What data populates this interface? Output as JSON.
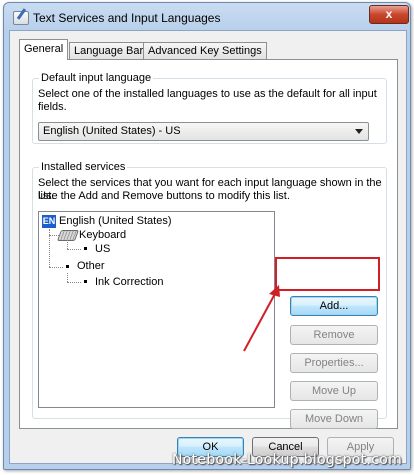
{
  "window": {
    "title": "Text Services and Input Languages",
    "close_glyph": "x"
  },
  "tabs": [
    {
      "label": "General",
      "active": true
    },
    {
      "label": "Language Bar",
      "active": false
    },
    {
      "label": "Advanced Key Settings",
      "active": false
    }
  ],
  "default_input": {
    "legend": "Default input language",
    "description_line1": "Select one of the installed languages to use as the default for all input",
    "description_line2": "fields.",
    "selected": "English (United States) - US"
  },
  "installed_services": {
    "legend": "Installed services",
    "description_line1": "Select the services that you want for each input language shown in the list.",
    "description_line2": "Use the Add and Remove buttons to modify this list.",
    "tree": {
      "language_badge": "EN",
      "language": "English (United States)",
      "keyboard": "Keyboard",
      "keyboard_layout": "US",
      "other": "Other",
      "other_service": "Ink Correction"
    },
    "buttons": {
      "add": "Add...",
      "remove": "Remove",
      "properties": "Properties...",
      "move_up": "Move Up",
      "move_down": "Move Down"
    }
  },
  "dialog_buttons": {
    "ok": "OK",
    "cancel": "Cancel",
    "apply": "Apply"
  },
  "watermark": "Notebook-Lookup.blogspot.com",
  "colors": {
    "highlight": "#d21f27",
    "language_badge": "#1d5ecf"
  },
  "icons": {
    "language": "language-badge-icon",
    "keyboard": "keyboard-icon",
    "app": "text-services-icon"
  }
}
